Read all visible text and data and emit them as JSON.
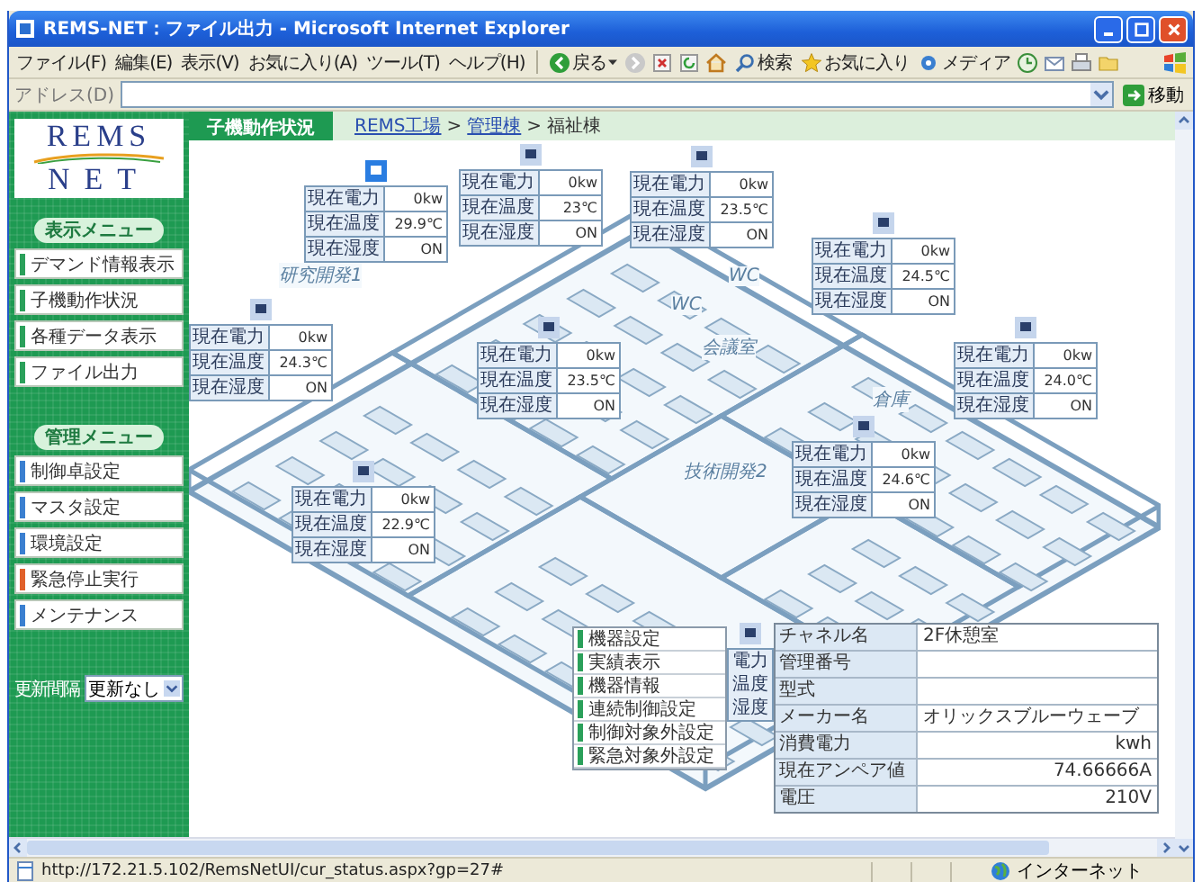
{
  "window": {
    "title": "REMS-NET：ファイル出力 - Microsoft Internet Explorer"
  },
  "menu_bar": [
    "ファイル(F)",
    "編集(E)",
    "表示(V)",
    "お気に入り(A)",
    "ツール(T)",
    "ヘルプ(H)"
  ],
  "toolbar": {
    "back": "戻る",
    "search": "検索",
    "favorites": "お気に入り",
    "media": "メディア"
  },
  "address_bar": {
    "label": "アドレス(D)",
    "go": "移動"
  },
  "sidebar": {
    "logo_top": "REMS",
    "logo_bottom": "NET",
    "sections": [
      {
        "title": "表示メニュー",
        "items": [
          {
            "label": "デマンド情報表示",
            "color": "#2aa05a"
          },
          {
            "label": "子機動作状況",
            "color": "#2aa05a"
          },
          {
            "label": "各種データ表示",
            "color": "#2aa05a"
          },
          {
            "label": "ファイル出力",
            "color": "#2aa05a"
          }
        ]
      },
      {
        "title": "管理メニュー",
        "items": [
          {
            "label": "制御卓設定",
            "color": "#3a7fd0"
          },
          {
            "label": "マスタ設定",
            "color": "#3a7fd0"
          },
          {
            "label": "環境設定",
            "color": "#3a7fd0"
          },
          {
            "label": "緊急停止実行",
            "color": "#e0602a"
          },
          {
            "label": "メンテナンス",
            "color": "#3a7fd0"
          }
        ]
      }
    ],
    "refresh": {
      "label": "更新間隔",
      "value": "更新なし"
    }
  },
  "page_header": {
    "title": "子機動作状況",
    "breadcrumb": [
      {
        "label": "REMS工場",
        "kind": "link"
      },
      {
        "label": ">",
        "kind": "separator"
      },
      {
        "label": "管理棟",
        "kind": "link"
      },
      {
        "label": ">",
        "kind": "separator"
      },
      {
        "label": "福祉棟",
        "kind": "current"
      }
    ]
  },
  "floor_plan": {
    "room_labels": [
      "研究開発1",
      "WC",
      "WC",
      "会議室",
      "技術開発2",
      "倉庫"
    ],
    "sensors": [
      {
        "selected": true,
        "rows": [
          {
            "label": "現在電力",
            "value": "0kw"
          },
          {
            "label": "現在温度",
            "value": "29.9℃"
          },
          {
            "label": "現在湿度",
            "value": "ON"
          }
        ]
      },
      {
        "selected": false,
        "rows": [
          {
            "label": "現在電力",
            "value": "0kw"
          },
          {
            "label": "現在温度",
            "value": "23℃"
          },
          {
            "label": "現在湿度",
            "value": "ON"
          }
        ]
      },
      {
        "selected": false,
        "rows": [
          {
            "label": "現在電力",
            "value": "0kw"
          },
          {
            "label": "現在温度",
            "value": "23.5℃"
          },
          {
            "label": "現在湿度",
            "value": "ON"
          }
        ]
      },
      {
        "selected": false,
        "rows": [
          {
            "label": "現在電力",
            "value": "0kw"
          },
          {
            "label": "現在温度",
            "value": "24.3℃"
          },
          {
            "label": "現在湿度",
            "value": "ON"
          }
        ]
      },
      {
        "selected": false,
        "rows": [
          {
            "label": "現在電力",
            "value": "0kw"
          },
          {
            "label": "現在温度",
            "value": "23.5℃"
          },
          {
            "label": "現在湿度",
            "value": "ON"
          }
        ]
      },
      {
        "selected": false,
        "rows": [
          {
            "label": "現在電力",
            "value": "0kw"
          },
          {
            "label": "現在温度",
            "value": "24.5℃"
          },
          {
            "label": "現在湿度",
            "value": "ON"
          }
        ]
      },
      {
        "selected": false,
        "rows": [
          {
            "label": "現在電力",
            "value": "0kw"
          },
          {
            "label": "現在温度",
            "value": "24.0℃"
          },
          {
            "label": "現在湿度",
            "value": "ON"
          }
        ]
      },
      {
        "selected": false,
        "rows": [
          {
            "label": "現在電力",
            "value": "0kw"
          },
          {
            "label": "現在温度",
            "value": "24.6℃"
          },
          {
            "label": "現在湿度",
            "value": "ON"
          }
        ]
      },
      {
        "selected": false,
        "rows": [
          {
            "label": "現在電力",
            "value": "0kw"
          },
          {
            "label": "現在温度",
            "value": "22.9℃"
          },
          {
            "label": "現在湿度",
            "value": "ON"
          }
        ]
      }
    ],
    "hidden_sensor": [
      "電力",
      "温度",
      "湿度"
    ],
    "context_menu": [
      "機器設定",
      "実績表示",
      "機器情報",
      "連続制御設定",
      "制御対象外設定",
      "緊急対象外設定"
    ],
    "device_details": [
      {
        "label": "チャネル名",
        "value": "2F休憩室",
        "kind": "text"
      },
      {
        "label": "管理番号",
        "kind": "text"
      },
      {
        "label": "型式",
        "kind": "text"
      },
      {
        "label": "メーカー名",
        "value": "オリックスブルーウェーブ",
        "kind": "text"
      },
      {
        "label": "消費電力",
        "value": "kwh",
        "kind": "number"
      },
      {
        "label": "現在アンペア値",
        "value": "74.66666A",
        "kind": "number"
      },
      {
        "label": "電圧",
        "value": "210V",
        "kind": "number"
      }
    ]
  },
  "status_bar": {
    "url": "http://172.21.5.102/RemsNetUI/cur_status.aspx?gp=27#",
    "zone": "インターネット"
  }
}
